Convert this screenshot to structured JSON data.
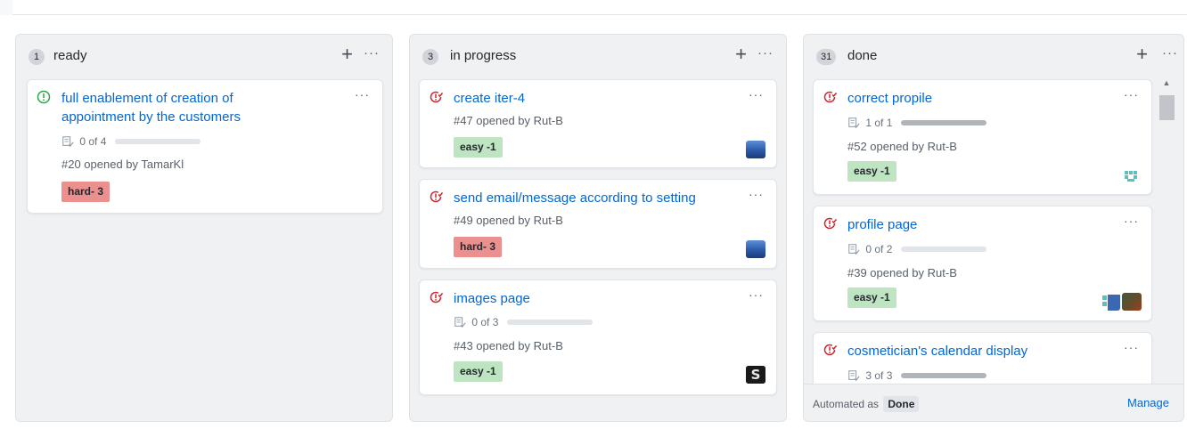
{
  "columns": [
    {
      "count": "1",
      "title": "ready",
      "cards": [
        {
          "title_line1": "full enablement of creation of",
          "title_line2": "appointment by the customers",
          "progress_text": "0 of 4",
          "progress_fraction": 0.0,
          "opened": "#20 opened by TamarKl",
          "label": "hard- 3"
        }
      ]
    },
    {
      "count": "3",
      "title": "in progress",
      "cards": [
        {
          "title": "create iter-4",
          "opened": "#47 opened by Rut-B",
          "label": "easy -1"
        },
        {
          "title": "send email/message according to setting",
          "opened": "#49 opened by Rut-B",
          "label": "hard- 3"
        },
        {
          "title": "images page",
          "progress_text": "0 of 3",
          "progress_fraction": 0.0,
          "opened": "#43 opened by Rut-B",
          "label": "easy -1"
        }
      ]
    },
    {
      "count": "31",
      "title": "done",
      "cards": [
        {
          "title": "correct propile",
          "progress_text": "1 of 1",
          "progress_fraction": 1.0,
          "opened": "#52 opened by Rut-B",
          "label": "easy -1"
        },
        {
          "title": "profile page",
          "progress_text": "0 of 2",
          "progress_fraction": 0.0,
          "opened": "#39 opened by Rut-B",
          "label": "easy -1"
        },
        {
          "title": "cosmetician's calendar display",
          "progress_text": "3 of 3",
          "progress_fraction": 1.0
        }
      ],
      "footer": {
        "automated_text": "Automated as",
        "automated_badge": "Done",
        "manage": "Manage"
      }
    }
  ],
  "icons": {
    "add": "+",
    "more": "···",
    "open_issue": "issue-opened-icon",
    "closed_issue": "issue-closed-icon",
    "tasks": "tasklist-icon"
  },
  "colors": {
    "link": "#0366d6",
    "open_issue": "#28a745",
    "closed_issue": "#cb2431",
    "label_easy": "#bfe4c2",
    "label_hard": "#ec8f8f"
  }
}
